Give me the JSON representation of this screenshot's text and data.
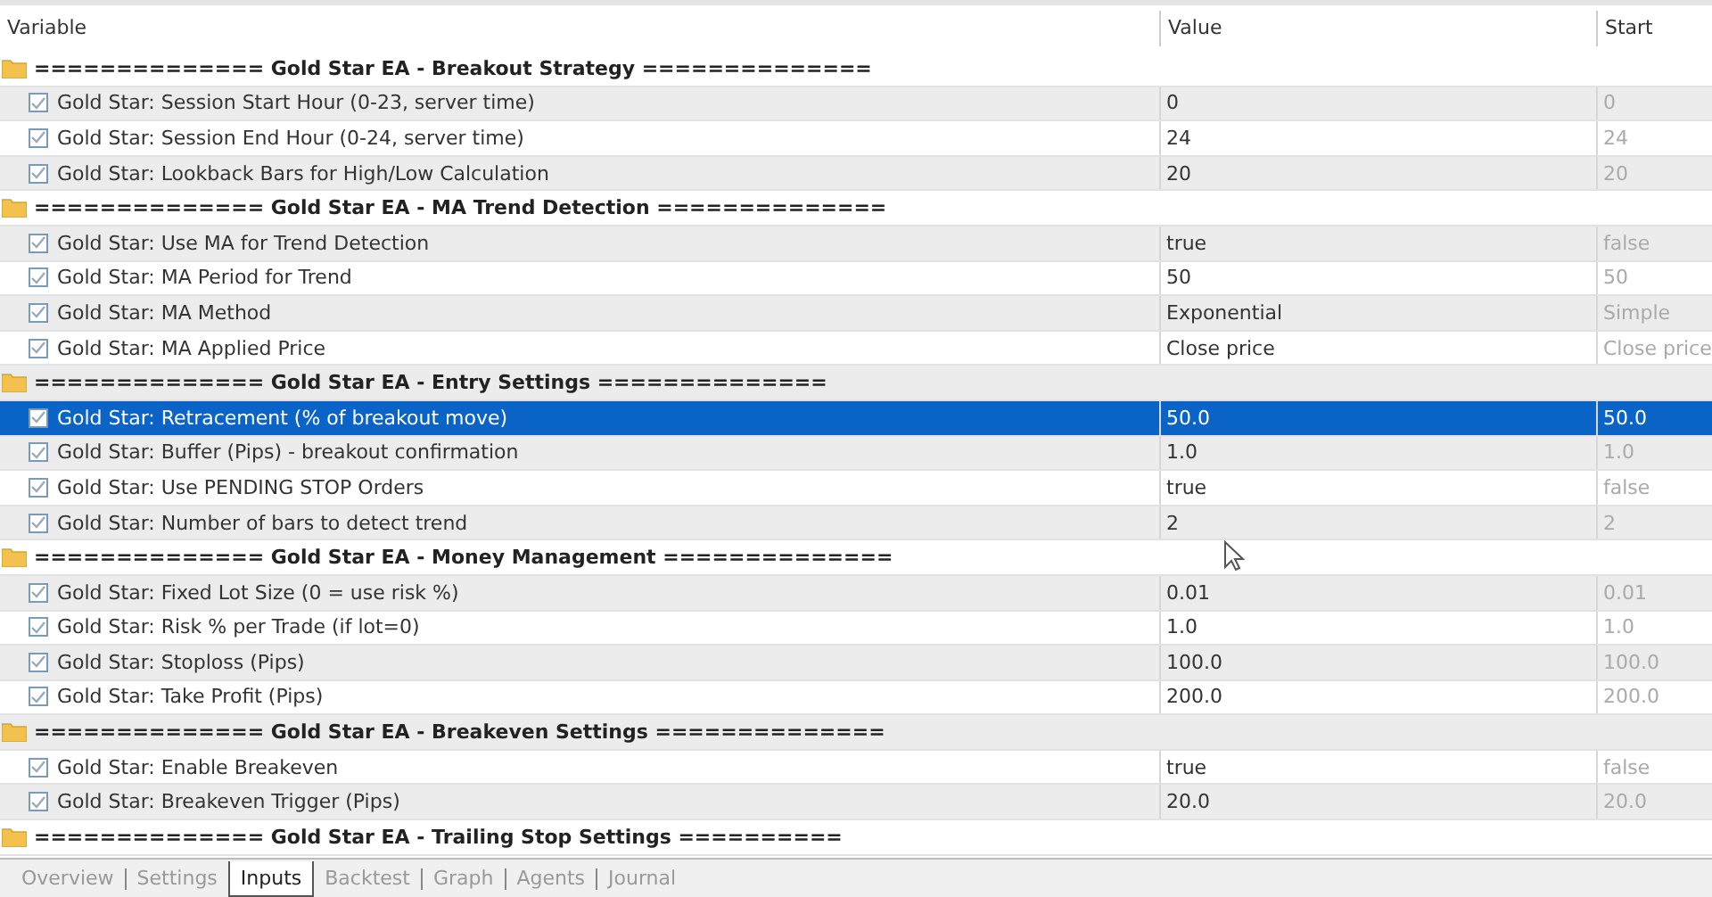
{
  "table": {
    "columns": [
      "Variable",
      "Value",
      "Start"
    ],
    "groups": [
      {
        "title": "============== Gold Star EA - Breakout Strategy ==============",
        "params": [
          {
            "name": "Gold Star: Session Start Hour (0-23, server time)",
            "value": "0",
            "start": "0",
            "checked": true,
            "selected": false
          },
          {
            "name": "Gold Star: Session End Hour (0-24, server time)",
            "value": "24",
            "start": "24",
            "checked": true,
            "selected": false
          },
          {
            "name": "Gold Star: Lookback Bars for High/Low Calculation",
            "value": "20",
            "start": "20",
            "checked": true,
            "selected": false
          }
        ]
      },
      {
        "title": "============== Gold Star EA - MA Trend Detection ==============",
        "params": [
          {
            "name": "Gold Star: Use MA for Trend Detection",
            "value": "true",
            "start": "false",
            "checked": true,
            "selected": false
          },
          {
            "name": "Gold Star: MA Period for Trend",
            "value": "50",
            "start": "50",
            "checked": true,
            "selected": false
          },
          {
            "name": "Gold Star: MA Method",
            "value": "Exponential",
            "start": "Simple",
            "checked": true,
            "selected": false
          },
          {
            "name": "Gold Star: MA Applied Price",
            "value": "Close price",
            "start": "Close price",
            "checked": true,
            "selected": false
          }
        ]
      },
      {
        "title": "============== Gold Star EA - Entry Settings ==============",
        "params": [
          {
            "name": "Gold Star: Retracement (% of breakout move)",
            "value": "50.0",
            "start": "50.0",
            "checked": true,
            "selected": true
          },
          {
            "name": "Gold Star: Buffer (Pips) - breakout confirmation",
            "value": "1.0",
            "start": "1.0",
            "checked": true,
            "selected": false
          },
          {
            "name": "Gold Star: Use PENDING STOP Orders",
            "value": "true",
            "start": "false",
            "checked": true,
            "selected": false
          },
          {
            "name": "Gold Star: Number of bars to detect trend",
            "value": "2",
            "start": "2",
            "checked": true,
            "selected": false
          }
        ]
      },
      {
        "title": "============== Gold Star EA - Money Management ==============",
        "params": [
          {
            "name": "Gold Star: Fixed Lot Size (0 = use risk %)",
            "value": "0.01",
            "start": "0.01",
            "checked": true,
            "selected": false
          },
          {
            "name": "Gold Star: Risk % per Trade (if lot=0)",
            "value": "1.0",
            "start": "1.0",
            "checked": true,
            "selected": false
          },
          {
            "name": "Gold Star: Stoploss (Pips)",
            "value": "100.0",
            "start": "100.0",
            "checked": true,
            "selected": false
          },
          {
            "name": "Gold Star: Take Profit (Pips)",
            "value": "200.0",
            "start": "200.0",
            "checked": true,
            "selected": false
          }
        ]
      },
      {
        "title": "============== Gold Star EA - Breakeven Settings ==============",
        "params": [
          {
            "name": "Gold Star: Enable Breakeven",
            "value": "true",
            "start": "false",
            "checked": true,
            "selected": false
          },
          {
            "name": "Gold Star: Breakeven Trigger (Pips)",
            "value": "20.0",
            "start": "20.0",
            "checked": true,
            "selected": false
          }
        ]
      },
      {
        "title": "============== Gold Star EA - Trailing Stop Settings =========="
      }
    ]
  },
  "tabs": [
    {
      "label": "Overview",
      "selected": false
    },
    {
      "label": "Settings",
      "selected": false
    },
    {
      "label": "Inputs",
      "selected": true
    },
    {
      "label": "Backtest",
      "selected": false
    },
    {
      "label": "Graph",
      "selected": false
    },
    {
      "label": "Agents",
      "selected": false
    },
    {
      "label": "Journal",
      "selected": false
    }
  ]
}
